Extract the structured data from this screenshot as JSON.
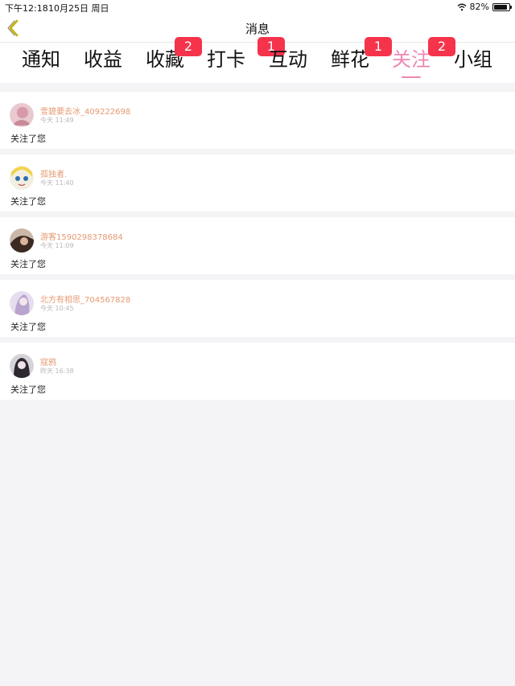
{
  "status_bar": {
    "time": "下午12:18",
    "date": "10月25日 周日",
    "battery": "82%",
    "icons": [
      "wifi-icon",
      "battery-icon"
    ]
  },
  "nav": {
    "title": "消息",
    "back_icon": "chevron-left-icon",
    "back_color": "#c4b000"
  },
  "tabs": [
    {
      "label": "通知",
      "badge": ""
    },
    {
      "label": "收益",
      "badge": ""
    },
    {
      "label": "收藏",
      "badge": "2"
    },
    {
      "label": "打卡",
      "badge": "1"
    },
    {
      "label": "互动",
      "badge": ""
    },
    {
      "label": "鲜花",
      "badge": "1"
    },
    {
      "label": "关注",
      "badge": "2",
      "active": true
    },
    {
      "label": "小组",
      "badge": ""
    }
  ],
  "colors": {
    "accent": "#ee86b3",
    "badge": "#f5334b",
    "username": "#e59a72",
    "background": "#f4f3f5"
  },
  "notifications": [
    {
      "username": "雪碧要去冰_409222698",
      "time": "今天 11:49",
      "message": "关注了您"
    },
    {
      "username": "孤独者.",
      "time": "今天 11:40",
      "message": "关注了您"
    },
    {
      "username": "游客1590298378684",
      "time": "今天 11:09",
      "message": "关注了您"
    },
    {
      "username": "北方有相思_704567828",
      "time": "今天 10:45",
      "message": "关注了您"
    },
    {
      "username": "寇鸦",
      "time": "昨天 16:38",
      "message": "关注了您"
    }
  ]
}
